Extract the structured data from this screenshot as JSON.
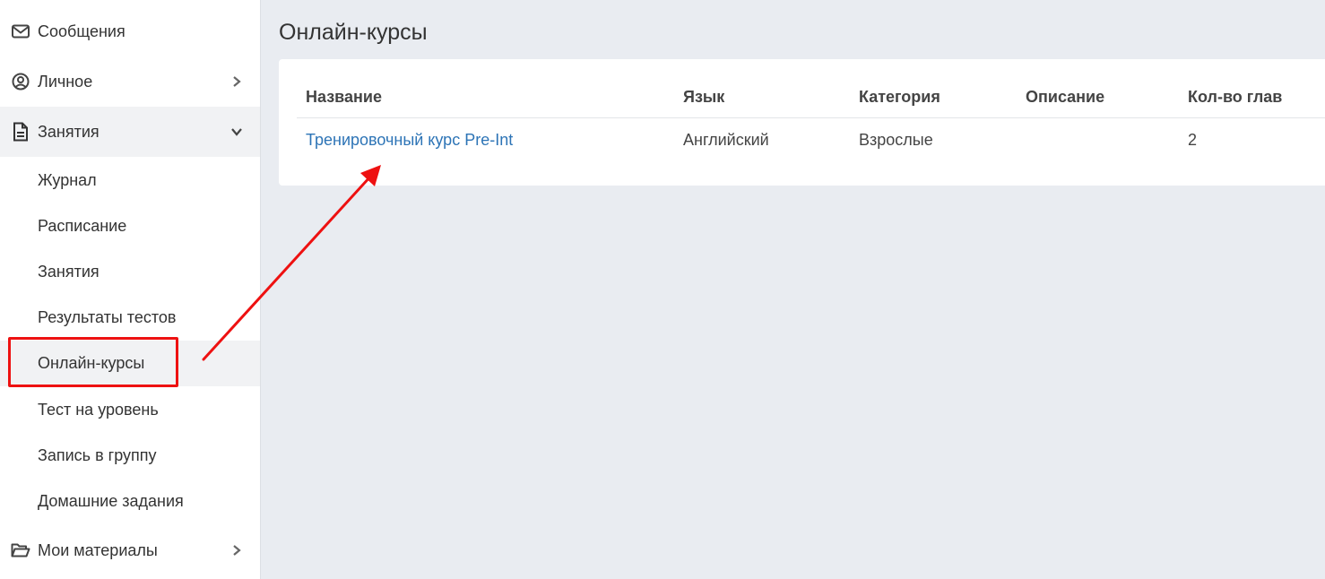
{
  "sidebar": {
    "messages": {
      "label": "Сообщения",
      "icon": "envelope-icon"
    },
    "personal": {
      "label": "Личное",
      "icon": "user-circle-icon"
    },
    "lessons": {
      "label": "Занятия",
      "icon": "document-icon",
      "expanded": true,
      "children": [
        {
          "label": "Журнал"
        },
        {
          "label": "Расписание"
        },
        {
          "label": "Занятия"
        },
        {
          "label": "Результаты тестов"
        },
        {
          "label": "Онлайн-курсы",
          "active": true
        },
        {
          "label": "Тест на уровень"
        },
        {
          "label": "Запись в группу"
        },
        {
          "label": "Домашние задания"
        }
      ]
    },
    "materials": {
      "label": "Мои материалы",
      "icon": "folder-open-icon"
    }
  },
  "main": {
    "title": "Онлайн-курсы",
    "table": {
      "headers": [
        "Название",
        "Язык",
        "Категория",
        "Описание",
        "Кол-во глав"
      ],
      "rows": [
        [
          "Тренировочный курс Pre-Int",
          "Английский",
          "Взрослые",
          "",
          "2"
        ]
      ]
    }
  },
  "colors": {
    "link": "#2d74b6",
    "highlight": "#ee1111",
    "background": "#e9ecf1"
  }
}
